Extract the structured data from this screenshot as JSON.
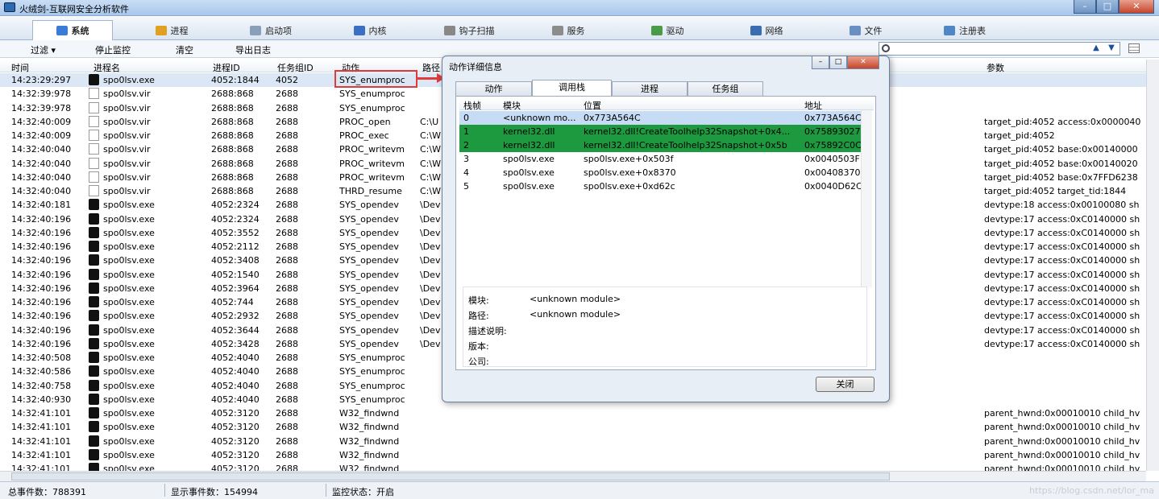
{
  "window": {
    "title": "火绒剑-互联网安全分析软件"
  },
  "tabs": [
    {
      "label": "系统",
      "icon": "system-icon",
      "color": "#3a7bd5"
    },
    {
      "label": "进程",
      "icon": "process-icon",
      "color": "#e0a020"
    },
    {
      "label": "启动项",
      "icon": "startup-icon",
      "color": "#8aa0b8"
    },
    {
      "label": "内核",
      "icon": "kernel-icon",
      "color": "#3b6fc4"
    },
    {
      "label": "钩子扫描",
      "icon": "hook-icon",
      "color": "#888888"
    },
    {
      "label": "服务",
      "icon": "service-icon",
      "color": "#8c8c8c"
    },
    {
      "label": "驱动",
      "icon": "driver-icon",
      "color": "#4a9a4a"
    },
    {
      "label": "网络",
      "icon": "network-icon",
      "color": "#3a6db0"
    },
    {
      "label": "文件",
      "icon": "file-icon",
      "color": "#6a8fc2"
    },
    {
      "label": "注册表",
      "icon": "registry-icon",
      "color": "#4f86c6"
    }
  ],
  "toolbar": {
    "filter": "过滤 ▾",
    "stop": "停止监控",
    "clear": "清空",
    "export": "导出日志"
  },
  "columns": {
    "time": "时间",
    "proc": "进程名",
    "pid": "进程ID",
    "group": "任务组ID",
    "action": "动作",
    "path": "路径",
    "params": "参数"
  },
  "rows": [
    {
      "time": "14:23:29:297",
      "proc": "spo0lsv.exe",
      "type": "exe",
      "pid": "4052:1844",
      "group": "4052",
      "action": "SYS_enumproc",
      "path": "",
      "params": ""
    },
    {
      "time": "14:32:39:978",
      "proc": "spo0lsv.vir",
      "type": "vir",
      "pid": "2688:868",
      "group": "2688",
      "action": "SYS_enumproc",
      "path": "",
      "params": ""
    },
    {
      "time": "14:32:39:978",
      "proc": "spo0lsv.vir",
      "type": "vir",
      "pid": "2688:868",
      "group": "2688",
      "action": "SYS_enumproc",
      "path": "",
      "params": ""
    },
    {
      "time": "14:32:40:009",
      "proc": "spo0lsv.vir",
      "type": "vir",
      "pid": "2688:868",
      "group": "2688",
      "action": "PROC_open",
      "path": "C:\\U",
      "params": "target_pid:4052 access:0x0000040"
    },
    {
      "time": "14:32:40:009",
      "proc": "spo0lsv.vir",
      "type": "vir",
      "pid": "2688:868",
      "group": "2688",
      "action": "PROC_exec",
      "path": "C:\\W",
      "params": "target_pid:4052"
    },
    {
      "time": "14:32:40:040",
      "proc": "spo0lsv.vir",
      "type": "vir",
      "pid": "2688:868",
      "group": "2688",
      "action": "PROC_writevm",
      "path": "C:\\W",
      "params": "target_pid:4052 base:0x00140000"
    },
    {
      "time": "14:32:40:040",
      "proc": "spo0lsv.vir",
      "type": "vir",
      "pid": "2688:868",
      "group": "2688",
      "action": "PROC_writevm",
      "path": "C:\\W",
      "params": "target_pid:4052 base:0x00140020"
    },
    {
      "time": "14:32:40:040",
      "proc": "spo0lsv.vir",
      "type": "vir",
      "pid": "2688:868",
      "group": "2688",
      "action": "PROC_writevm",
      "path": "C:\\W",
      "params": "target_pid:4052 base:0x7FFD6238"
    },
    {
      "time": "14:32:40:040",
      "proc": "spo0lsv.vir",
      "type": "vir",
      "pid": "2688:868",
      "group": "2688",
      "action": "THRD_resume",
      "path": "C:\\W",
      "params": "target_pid:4052 target_tid:1844"
    },
    {
      "time": "14:32:40:181",
      "proc": "spo0lsv.exe",
      "type": "exe",
      "pid": "4052:2324",
      "group": "2688",
      "action": "SYS_opendev",
      "path": "\\Dev",
      "params": "devtype:18 access:0x00100080 sh"
    },
    {
      "time": "14:32:40:196",
      "proc": "spo0lsv.exe",
      "type": "exe",
      "pid": "4052:2324",
      "group": "2688",
      "action": "SYS_opendev",
      "path": "\\Dev",
      "params": "devtype:17 access:0xC0140000 sh"
    },
    {
      "time": "14:32:40:196",
      "proc": "spo0lsv.exe",
      "type": "exe",
      "pid": "4052:3552",
      "group": "2688",
      "action": "SYS_opendev",
      "path": "\\Dev",
      "params": "devtype:17 access:0xC0140000 sh"
    },
    {
      "time": "14:32:40:196",
      "proc": "spo0lsv.exe",
      "type": "exe",
      "pid": "4052:2112",
      "group": "2688",
      "action": "SYS_opendev",
      "path": "\\Dev",
      "params": "devtype:17 access:0xC0140000 sh"
    },
    {
      "time": "14:32:40:196",
      "proc": "spo0lsv.exe",
      "type": "exe",
      "pid": "4052:3408",
      "group": "2688",
      "action": "SYS_opendev",
      "path": "\\Dev",
      "params": "devtype:17 access:0xC0140000 sh"
    },
    {
      "time": "14:32:40:196",
      "proc": "spo0lsv.exe",
      "type": "exe",
      "pid": "4052:1540",
      "group": "2688",
      "action": "SYS_opendev",
      "path": "\\Dev",
      "params": "devtype:17 access:0xC0140000 sh"
    },
    {
      "time": "14:32:40:196",
      "proc": "spo0lsv.exe",
      "type": "exe",
      "pid": "4052:3964",
      "group": "2688",
      "action": "SYS_opendev",
      "path": "\\Dev",
      "params": "devtype:17 access:0xC0140000 sh"
    },
    {
      "time": "14:32:40:196",
      "proc": "spo0lsv.exe",
      "type": "exe",
      "pid": "4052:744",
      "group": "2688",
      "action": "SYS_opendev",
      "path": "\\Dev",
      "params": "devtype:17 access:0xC0140000 sh"
    },
    {
      "time": "14:32:40:196",
      "proc": "spo0lsv.exe",
      "type": "exe",
      "pid": "4052:2932",
      "group": "2688",
      "action": "SYS_opendev",
      "path": "\\Dev",
      "params": "devtype:17 access:0xC0140000 sh"
    },
    {
      "time": "14:32:40:196",
      "proc": "spo0lsv.exe",
      "type": "exe",
      "pid": "4052:3644",
      "group": "2688",
      "action": "SYS_opendev",
      "path": "\\Dev",
      "params": "devtype:17 access:0xC0140000 sh"
    },
    {
      "time": "14:32:40:196",
      "proc": "spo0lsv.exe",
      "type": "exe",
      "pid": "4052:3428",
      "group": "2688",
      "action": "SYS_opendev",
      "path": "\\Dev",
      "params": "devtype:17 access:0xC0140000 sh"
    },
    {
      "time": "14:32:40:508",
      "proc": "spo0lsv.exe",
      "type": "exe",
      "pid": "4052:4040",
      "group": "2688",
      "action": "SYS_enumproc",
      "path": "",
      "params": ""
    },
    {
      "time": "14:32:40:586",
      "proc": "spo0lsv.exe",
      "type": "exe",
      "pid": "4052:4040",
      "group": "2688",
      "action": "SYS_enumproc",
      "path": "",
      "params": ""
    },
    {
      "time": "14:32:40:758",
      "proc": "spo0lsv.exe",
      "type": "exe",
      "pid": "4052:4040",
      "group": "2688",
      "action": "SYS_enumproc",
      "path": "",
      "params": ""
    },
    {
      "time": "14:32:40:930",
      "proc": "spo0lsv.exe",
      "type": "exe",
      "pid": "4052:4040",
      "group": "2688",
      "action": "SYS_enumproc",
      "path": "",
      "params": ""
    },
    {
      "time": "14:32:41:101",
      "proc": "spo0lsv.exe",
      "type": "exe",
      "pid": "4052:3120",
      "group": "2688",
      "action": "W32_findwnd",
      "path": "",
      "params": "parent_hwnd:0x00010010 child_hv"
    },
    {
      "time": "14:32:41:101",
      "proc": "spo0lsv.exe",
      "type": "exe",
      "pid": "4052:3120",
      "group": "2688",
      "action": "W32_findwnd",
      "path": "",
      "params": "parent_hwnd:0x00010010 child_hv"
    },
    {
      "time": "14:32:41:101",
      "proc": "spo0lsv.exe",
      "type": "exe",
      "pid": "4052:3120",
      "group": "2688",
      "action": "W32_findwnd",
      "path": "",
      "params": "parent_hwnd:0x00010010 child_hv"
    },
    {
      "time": "14:32:41:101",
      "proc": "spo0lsv.exe",
      "type": "exe",
      "pid": "4052:3120",
      "group": "2688",
      "action": "W32_findwnd",
      "path": "",
      "params": "parent_hwnd:0x00010010 child_hv"
    },
    {
      "time": "14:32:41:101",
      "proc": "spo0lsv.exe",
      "type": "exe",
      "pid": "4052:3120",
      "group": "2688",
      "action": "W32_findwnd",
      "path": "",
      "params": "parent_hwnd:0x00010010 child_hv"
    }
  ],
  "dialog": {
    "title": "动作详细信息",
    "tabs": [
      "动作",
      "调用栈",
      "进程",
      "任务组"
    ],
    "cols": {
      "frame": "栈帧",
      "module": "模块",
      "location": "位置",
      "address": "地址"
    },
    "frames": [
      {
        "frame": "0",
        "module": "<unknown mo...",
        "location": "0x773A564C",
        "address": "0x773A564C",
        "style": "sel"
      },
      {
        "frame": "1",
        "module": "kernel32.dll",
        "location": "kernel32.dll!CreateToolhelp32Snapshot+0x4...",
        "address": "0x75893027",
        "style": "green"
      },
      {
        "frame": "2",
        "module": "kernel32.dll",
        "location": "kernel32.dll!CreateToolhelp32Snapshot+0x5b",
        "address": "0x75892C0C",
        "style": "green"
      },
      {
        "frame": "3",
        "module": "spo0lsv.exe",
        "location": "spo0lsv.exe+0x503f",
        "address": "0x0040503F",
        "style": ""
      },
      {
        "frame": "4",
        "module": "spo0lsv.exe",
        "location": "spo0lsv.exe+0x8370",
        "address": "0x00408370",
        "style": ""
      },
      {
        "frame": "5",
        "module": "spo0lsv.exe",
        "location": "spo0lsv.exe+0xd62c",
        "address": "0x0040D62C",
        "style": ""
      }
    ],
    "info": {
      "module_label": "模块:",
      "module_value": "<unknown module>",
      "path_label": "路径:",
      "path_value": "<unknown module>",
      "desc_label": "描述说明:",
      "version_label": "版本:",
      "company_label": "公司:"
    },
    "close": "关闭"
  },
  "status": {
    "total": "总事件数：788391",
    "shown": "显示事件数：154994",
    "monitor": "监控状态：开启",
    "watermark": "https://blog.csdn.net/lor_ma"
  }
}
